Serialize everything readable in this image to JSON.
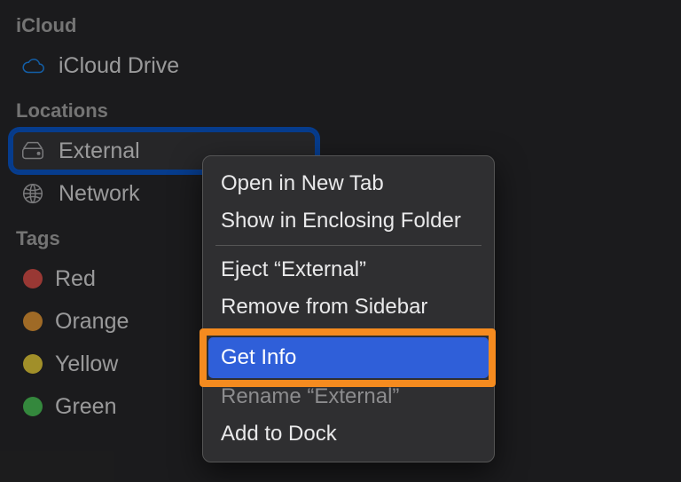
{
  "sidebar": {
    "sections": {
      "icloud": {
        "label": "iCloud",
        "items": [
          {
            "label": "iCloud Drive"
          }
        ]
      },
      "locations": {
        "label": "Locations",
        "items": [
          {
            "label": "External"
          },
          {
            "label": "Network"
          }
        ]
      },
      "tags": {
        "label": "Tags",
        "items": [
          {
            "label": "Red"
          },
          {
            "label": "Orange"
          },
          {
            "label": "Yellow"
          },
          {
            "label": "Green"
          }
        ]
      }
    }
  },
  "context_menu": {
    "items": [
      {
        "label": "Open in New Tab"
      },
      {
        "label": "Show in Enclosing Folder"
      },
      {
        "sep": true
      },
      {
        "label": "Eject “External”"
      },
      {
        "label": "Remove from Sidebar"
      },
      {
        "sep": true
      },
      {
        "label": "Get Info",
        "highlighted": true
      },
      {
        "label": "Rename “External”",
        "obscured": true
      },
      {
        "label": "Add to Dock"
      }
    ]
  }
}
